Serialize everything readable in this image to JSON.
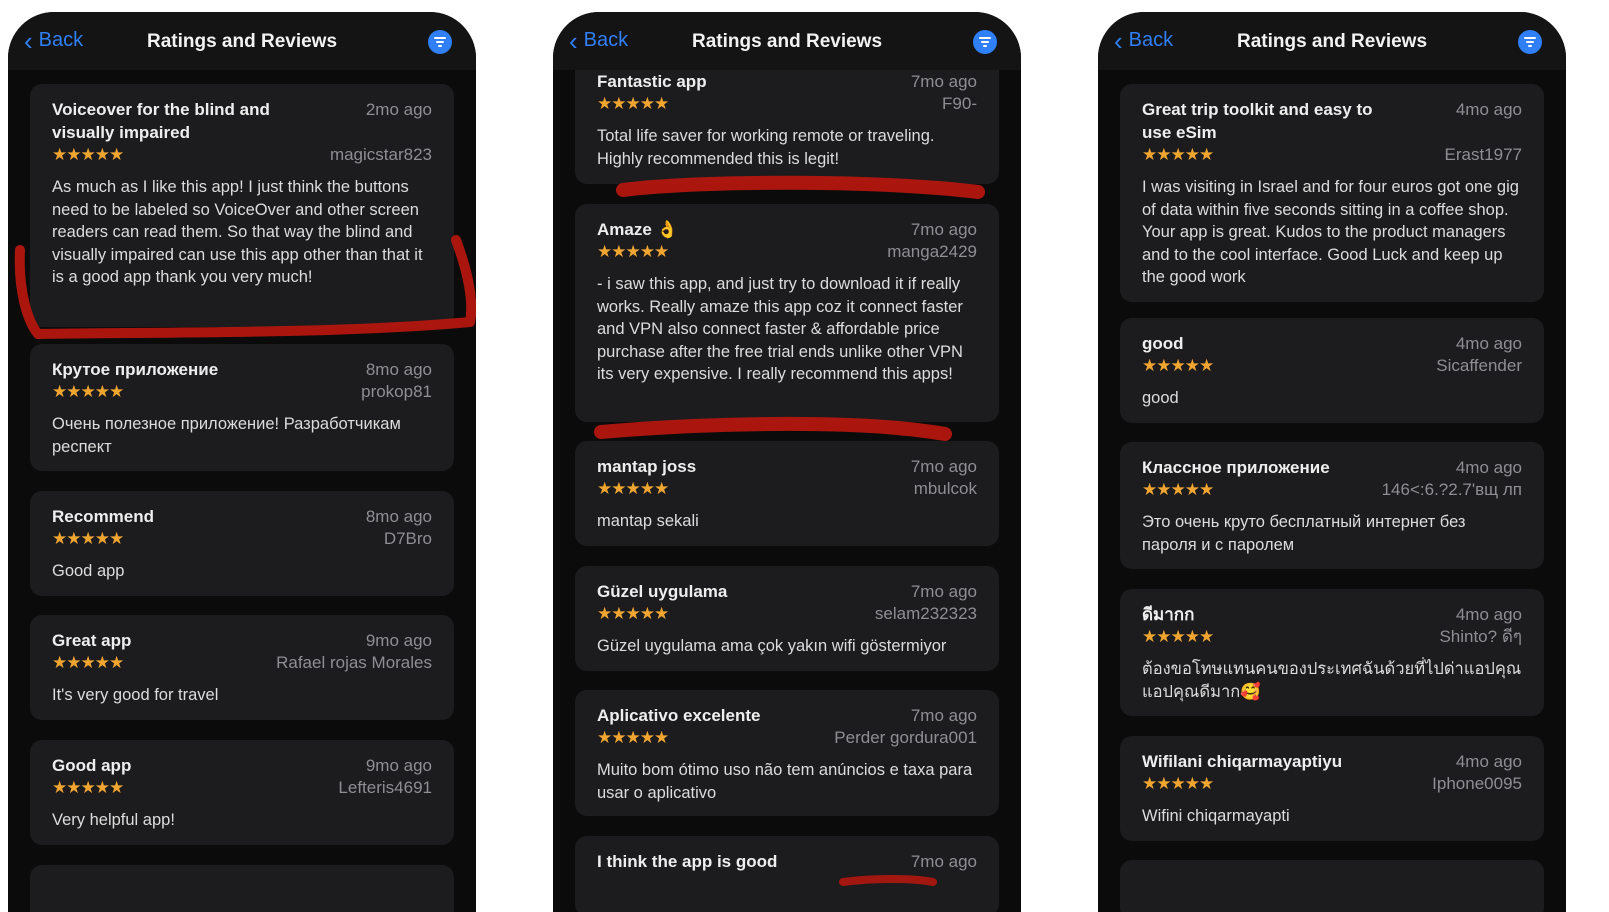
{
  "phones": [
    {
      "nav": {
        "back": "Back",
        "title": "Ratings and Reviews"
      },
      "reviews": [
        {
          "title": "Voiceover for the blind and visually impaired",
          "date": "2mo ago",
          "stars": "★★★★★",
          "author": "magicstar823",
          "body": "As much as I like this app! I just think the buttons need to be labeled so VoiceOver and other screen readers can read them. So that way the blind and visually impaired can use this app other than that it is a good app thank you very much!"
        },
        {
          "title": "Крутое приложение",
          "date": "8mo ago",
          "stars": "★★★★★",
          "author": "prokop81",
          "body": "Очень полезное приложение! Разработчикам респект"
        },
        {
          "title": "Recommend",
          "date": "8mo ago",
          "stars": "★★★★★",
          "author": "D7Bro",
          "body": "Good app"
        },
        {
          "title": "Great app",
          "date": "9mo ago",
          "stars": "★★★★★",
          "author": "Rafael rojas Morales",
          "body": "It's very good for travel"
        },
        {
          "title": "Good app",
          "date": "9mo ago",
          "stars": "★★★★★",
          "author": "Lefteris4691",
          "body": "Very helpful app!"
        }
      ]
    },
    {
      "nav": {
        "back": "Back",
        "title": "Ratings and Reviews"
      },
      "reviews": [
        {
          "title": "Fantastic app",
          "date": "7mo ago",
          "stars": "★★★★★",
          "author": "F90-",
          "body": "Total life saver for working remote or traveling. Highly recommended this is legit!"
        },
        {
          "title": "Amaze 👌",
          "date": "7mo ago",
          "stars": "★★★★★",
          "author": "manga2429",
          "body": "- i saw this app, and just try to download it if really works. Really amaze this app coz it connect faster and VPN also connect faster & affordable price purchase after the free trial ends unlike other VPN its very expensive. I really recommend this apps!"
        },
        {
          "title": "mantap joss",
          "date": "7mo ago",
          "stars": "★★★★★",
          "author": "mbulcok",
          "body": "mantap sekali"
        },
        {
          "title": "Güzel uygulama",
          "date": "7mo ago",
          "stars": "★★★★★",
          "author": "selam232323",
          "body": "Güzel uygulama ama çok yakın wifi göstermiyor"
        },
        {
          "title": "Aplicativo excelente",
          "date": "7mo ago",
          "stars": "★★★★★",
          "author": "Perder gordura001",
          "body": "Muito bom ótimo uso não tem anúncios e taxa para usar o aplicativo"
        },
        {
          "title": "I think the app is good",
          "date": "7mo ago",
          "stars": "",
          "author": "",
          "body": ""
        }
      ]
    },
    {
      "nav": {
        "back": "Back",
        "title": "Ratings and Reviews"
      },
      "reviews": [
        {
          "title": "Great trip toolkit and easy to use eSim",
          "date": "4mo ago",
          "stars": "★★★★★",
          "author": "Erast1977",
          "body": "I was visiting in Israel and for four euros got one gig of data within five seconds sitting in a coffee shop. Your app is great. Kudos to the product managers and to the cool interface. Good Luck and keep up the good work"
        },
        {
          "title": "good",
          "date": "4mo ago",
          "stars": "★★★★★",
          "author": "Sicaffender",
          "body": "good"
        },
        {
          "title": "Классное приложение",
          "date": "4mo ago",
          "stars": "★★★★★",
          "author": "146<:6.?2.7'вщ лп",
          "body": "Это очень круто бесплатный интернет без пароля и с паролем"
        },
        {
          "title": "ดีมากก",
          "date": "4mo ago",
          "stars": "★★★★★",
          "author": "Shinto? ดีๆ",
          "body": "ต้องขอโทษแทนคนของประเทศฉันด้วยที่ไปด่าแอปคุณ แอปคุณดีมาก🥰"
        },
        {
          "title": "Wifilani chiqarmayaptiyu",
          "date": "4mo ago",
          "stars": "★★★★★",
          "author": "Iphone0095",
          "body": "Wifini chiqarmayapti"
        }
      ]
    }
  ],
  "colors": {
    "accent": "#2f7ff6",
    "star": "#f0a531",
    "highlight": "#b3170f",
    "card": "#1c1c1e"
  }
}
